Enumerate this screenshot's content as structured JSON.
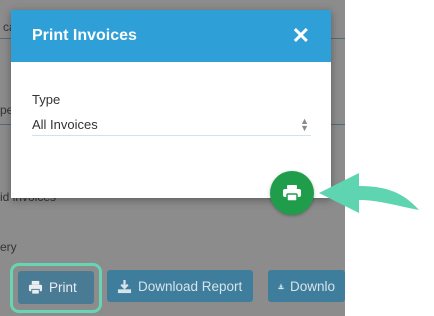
{
  "background_fragments": {
    "f1": "ca",
    "f2": "pe",
    "f3": "id invoices",
    "f4": "ery"
  },
  "modal": {
    "title": "Print Invoices",
    "close_glyph": "✕",
    "type_label": "Type",
    "type_value": "All Invoices"
  },
  "buttons": {
    "print": "Print",
    "download_report": "Download Report",
    "download_partial": "Downlo"
  },
  "colors": {
    "modal_header": "#2f9fd8",
    "fab": "#1f9d4b",
    "highlight": "#67d4b3",
    "arrow": "#5fd4b0"
  },
  "icons": [
    "close-icon",
    "print-icon",
    "download-icon",
    "select-chevron-icon",
    "pointer-arrow"
  ]
}
